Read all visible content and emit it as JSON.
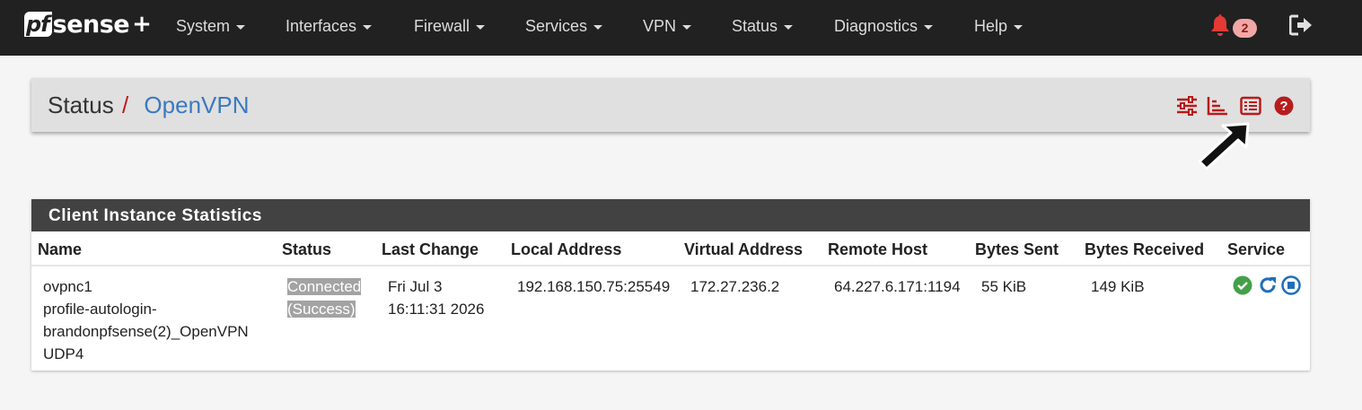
{
  "navbar": {
    "logo": {
      "pf": "pf",
      "sense": "sense",
      "plus": "+"
    },
    "menu": [
      {
        "label": "System"
      },
      {
        "label": "Interfaces"
      },
      {
        "label": "Firewall"
      },
      {
        "label": "Services"
      },
      {
        "label": "VPN"
      },
      {
        "label": "Status"
      },
      {
        "label": "Diagnostics"
      },
      {
        "label": "Help"
      }
    ],
    "notification_count": "2",
    "icons": {
      "notifications": "bell-icon",
      "logout": "sign-out-icon"
    }
  },
  "breadcrumb": {
    "parent": "Status",
    "separator": "/",
    "current": "OpenVPN",
    "tool_icons": [
      "sliders-icon",
      "bar-chart-icon",
      "list-log-icon",
      "help-icon"
    ]
  },
  "stats": {
    "title": "Client Instance Statistics",
    "columns": [
      "Name",
      "Status",
      "Last Change",
      "Local Address",
      "Virtual Address",
      "Remote Host",
      "Bytes Sent",
      "Bytes Received",
      "Service"
    ],
    "rows": [
      {
        "name": [
          "ovpnc1",
          "profile-autologin-",
          "brandonpfsense(2)_OpenVPN",
          "UDP4"
        ],
        "status": [
          "Connected",
          "(Success)"
        ],
        "last_change": [
          "Fri Jul 3",
          "16:11:31 2026"
        ],
        "local_address": "192.168.150.75:25549",
        "virtual_address": "172.27.236.2",
        "remote_host": "64.227.6.171:1194",
        "bytes_sent": "55 KiB",
        "bytes_received": "149 KiB",
        "service_icons": [
          "check-circle-icon",
          "restart-icon",
          "stop-circle-icon"
        ]
      }
    ]
  },
  "colors": {
    "navbar_bg": "#212121",
    "accent_red": "#b71c1c",
    "link_blue": "#3a7abf",
    "panel_header": "#424242",
    "success_green": "#43a047",
    "service_blue": "#1e6fb8"
  }
}
